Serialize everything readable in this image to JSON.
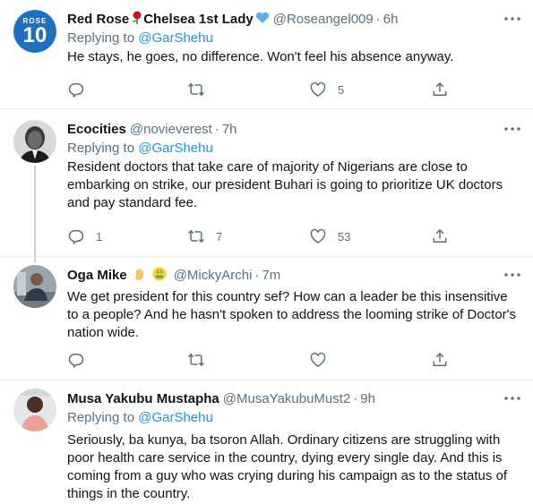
{
  "tweets": [
    {
      "name": "Red Rose",
      "name_suffix": "Chelsea 1st Lady",
      "handle": "@Roseangel009",
      "time": "6h",
      "replying_label": "Replying to ",
      "replying_to": "@GarShehu",
      "text": "He stays, he goes, no difference. Won't feel his absence anyway.",
      "reply_count": "",
      "retweet_count": "",
      "like_count": "5",
      "avatar_label_small": "ROSE",
      "avatar_label_big": "10"
    },
    {
      "name": "Ecocities",
      "handle": "@novieverest",
      "time": "7h",
      "replying_label": "Replying to ",
      "replying_to": "@GarShehu",
      "text": "Resident doctors that take care of majority of Nigerians are close to embarking on strike, our president Buhari is going to prioritize UK doctors and pay standard fee.",
      "reply_count": "1",
      "retweet_count": "7",
      "like_count": "53"
    },
    {
      "name": "Oga Mike",
      "handle": "@MickyArchi",
      "time": "7m",
      "text": "We get president for this country sef? How can a leader be this insensitive to a people? And he hasn't spoken to address the looming strike of Doctor's nation wide.",
      "reply_count": "",
      "retweet_count": "",
      "like_count": ""
    },
    {
      "name": "Musa Yakubu Mustapha",
      "handle": "@MusaYakubuMust2",
      "time": "9h",
      "replying_label": "Replying to ",
      "replying_to": "@GarShehu",
      "text": "Seriously, ba kunya, ba tsoron Allah. Ordinary citizens are struggling with poor health care service in the country, dying every single day. And this is coming from a guy who was crying during his campaign as to the status of things in the country."
    }
  ],
  "separator": "·",
  "colors": {
    "accent": "#1b95e0",
    "secondary_text": "#5b7083",
    "divider": "#e6ecf0"
  },
  "icons": [
    "reply-icon",
    "retweet-icon",
    "like-icon",
    "share-icon",
    "more-icon",
    "rose-emoji-icon",
    "blue-heart-emoji-icon",
    "waving-hand-emoji-icon",
    "money-mouth-emoji-icon"
  ]
}
